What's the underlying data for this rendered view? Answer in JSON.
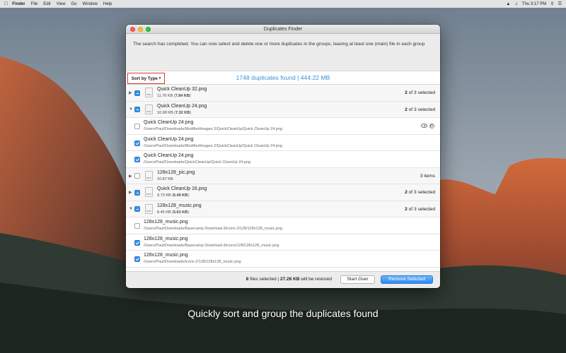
{
  "menubar": {
    "app": "Finder",
    "items": [
      "File",
      "Edit",
      "View",
      "Go",
      "Window",
      "Help"
    ],
    "clock": "Thu 3:17 PM"
  },
  "window": {
    "title": "Duplicates Finder",
    "info": "The search has completed. You can now select and delete one or more duplicates in the groups, leaving at least one (main) file in each group",
    "sort_label": "Sort by Type",
    "summary": "1748 duplicates found | 444.22 MB"
  },
  "groups": [
    {
      "name": "Quick CleanUp 32.png",
      "size": "11.76 KB",
      "sel_size": "7.84 KB",
      "status_num": "2",
      "status_text": "of 3 selected"
    },
    {
      "name": "Quick CleanUp 24.png",
      "size": "10.98 KB",
      "sel_size": "7.32 KB",
      "status_num": "2",
      "status_text": "of 3 selected"
    },
    {
      "name": "128x128_pic.png",
      "size": "10.87 KB",
      "status_plain": "3 items"
    },
    {
      "name": "Quick CleanUp 16.png",
      "size": "9.73 KB",
      "sel_size": "6.49 KB",
      "status_num": "2",
      "status_text": "of 3 selected"
    },
    {
      "name": "128x128_music.png",
      "size": "8.45 KB",
      "sel_size": "5.63 KB",
      "status_num": "2",
      "status_text": "of 3 selected"
    }
  ],
  "items": [
    {
      "name": "Quick CleanUp 24.png",
      "path": "/Users/Paul/Downloads/ModifiedImages 2/QuickCleanUp/Quick CleanUp 24.png"
    },
    {
      "name": "Quick CleanUp 24.png",
      "path": "/Users/Paul/Downloads/ModifiedImages 2/QuickCleanUp/Quick CleanUp 24.png"
    },
    {
      "name": "Quick CleanUp 24.png",
      "path": "/Users/Paul/Downloads/QuickCleanUp/Quick CleanUp 24.png"
    },
    {
      "name": "128x128_music.png",
      "path": "/Users/Paul/Downloads/Basecamp Download-3/icons 2/128/128x128_music.png"
    },
    {
      "name": "128x128_music.png",
      "path": "/Users/Paul/Downloads/Basecamp Download-3/icons/128/128x128_music.png"
    },
    {
      "name": "128x128_music.png",
      "path": "/Users/Paul/Downloads/icons 2/128/128x128_music.png"
    }
  ],
  "footer": {
    "selected_count": "8",
    "selected_label": "files selected |",
    "restored_size": "27.28 KB",
    "restored_label": "will be restored",
    "start_over": "Start Over",
    "remove_selected": "Remove Selected"
  },
  "caption": "Quickly sort and group the duplicates found",
  "colors": {
    "accent": "#3a8ee6",
    "summary": "#3d8fd6",
    "sort_outline": "#e0352b"
  }
}
